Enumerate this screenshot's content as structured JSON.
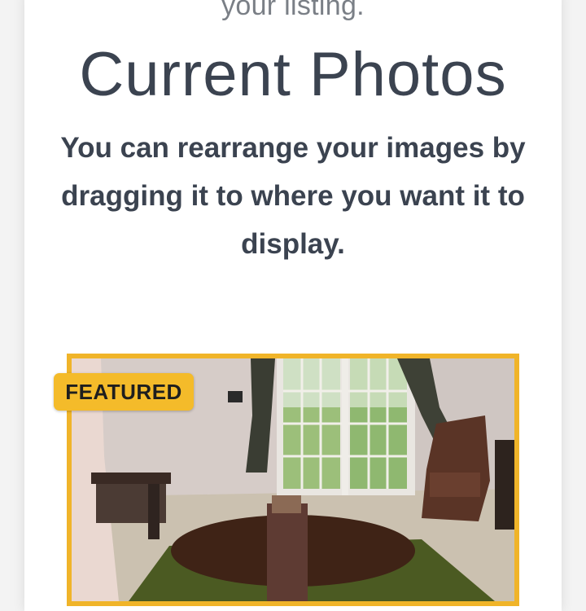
{
  "intro": {
    "tail_text": "your listing."
  },
  "photos_section": {
    "title": "Current Photos",
    "instructions": "You can rearrange your images by dragging it to where you want it to display."
  },
  "photo_list": [
    {
      "badge": "FEATURED",
      "is_featured": true,
      "subject": "living room with french doors"
    }
  ],
  "colors": {
    "accent": "#f4bb2a",
    "tile_border": "#f0b429",
    "heading": "#3b4350",
    "muted_text": "#7a7f86"
  }
}
